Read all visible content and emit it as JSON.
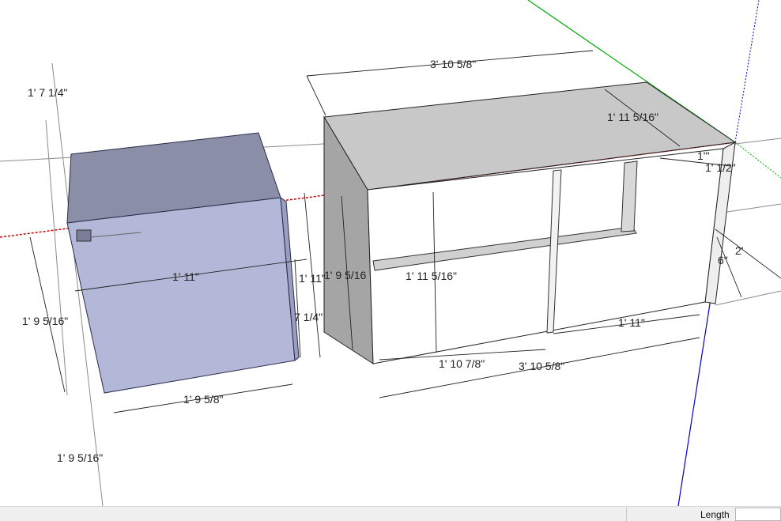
{
  "viewport": {
    "dimensions": [
      "1' 7 1/4\"",
      "1' 9 5/16\"",
      "1' 11\"",
      "1' 11\"",
      "7 1/4\"",
      "1' 9 5/8\"",
      "1' 9 5/16\"",
      "3' 10 5/8\"",
      "1' 11 5/16\"",
      "1' 9 5/16",
      "1' 11 5/16\"",
      "1' 10 7/8\"",
      "3' 10 5/8\"",
      "1' 11\"",
      "2'",
      "6\"",
      "1'\"",
      "1' 1/2\""
    ]
  },
  "statusbar": {
    "vcb_label": "Length",
    "vcb_value": ""
  },
  "colors": {
    "x_axis": "#cc0000",
    "y_axis": "#00aa00",
    "z_axis": "#0000cc",
    "selected_face_front": "#b4b8d8",
    "selected_face_top": "#8a8ea6",
    "cabinet_top": "#c8c8c8",
    "cabinet_side": "#a5a5a5"
  }
}
